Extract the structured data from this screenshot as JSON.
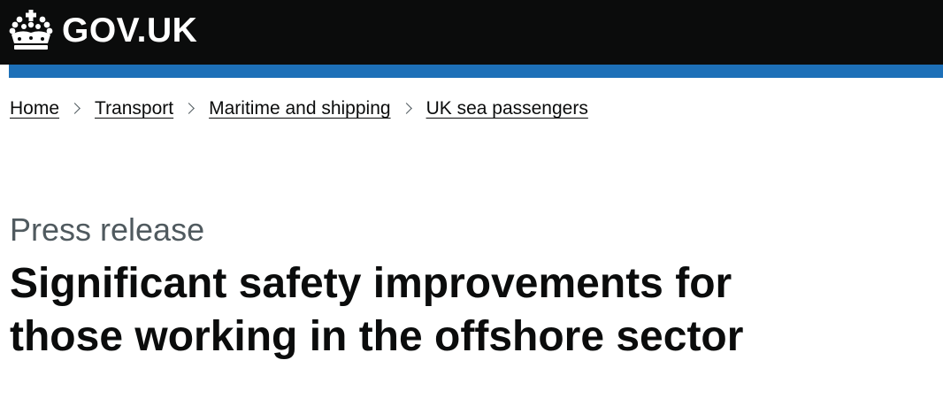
{
  "header": {
    "logo_text": "GOV.UK",
    "logo_icon": "crown-icon"
  },
  "breadcrumb": {
    "items": [
      {
        "label": "Home"
      },
      {
        "label": "Transport"
      },
      {
        "label": "Maritime and shipping"
      },
      {
        "label": "UK sea passengers"
      }
    ],
    "separator_icon": "chevron-right-icon"
  },
  "main": {
    "caption": "Press release",
    "title": "Significant safety improvements for those working in the offshore sector"
  },
  "colors": {
    "header_bg": "#0b0c0c",
    "accent_bar": "#1d70b8",
    "caption_text": "#505a5f",
    "body_text": "#0b0c0c"
  }
}
